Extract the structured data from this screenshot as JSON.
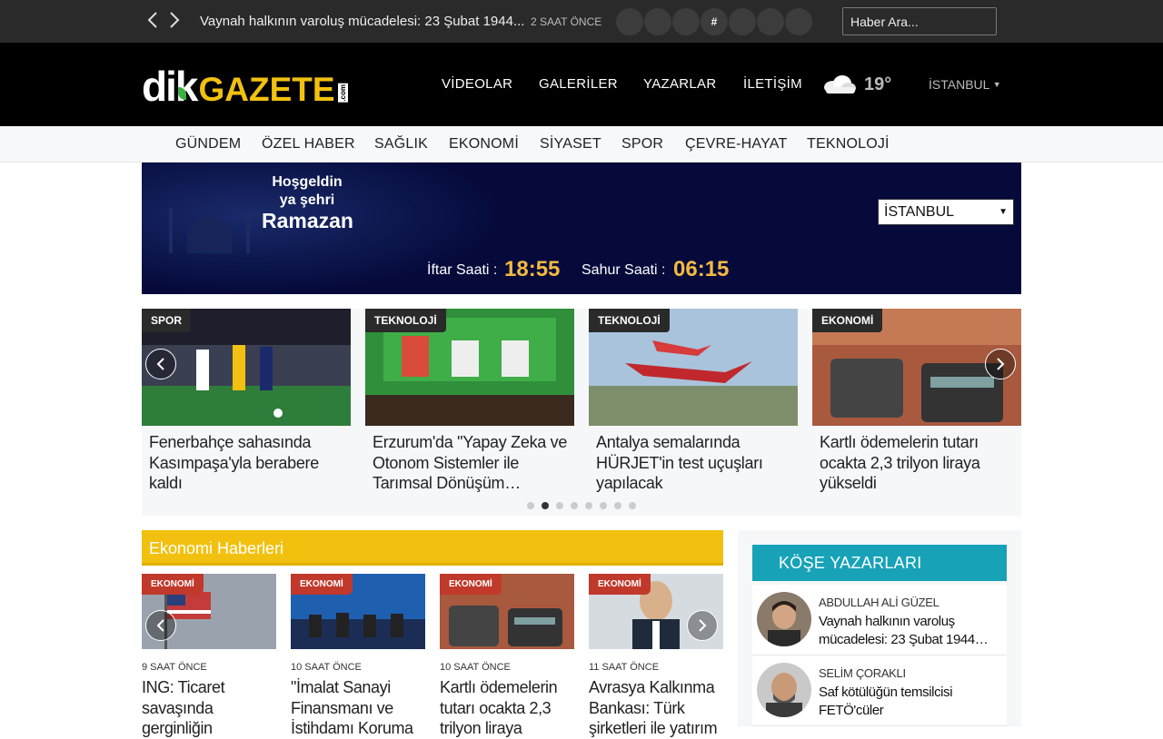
{
  "topbar": {
    "ticker_text": "Vaynah halkının varoluş mücadelesi: 23 Şubat 1944...",
    "ticker_time": "2 SAAT ÖNCE",
    "prev_icon": "chevron-left-icon",
    "next_icon": "chevron-right-icon",
    "social_hash": "#",
    "search_placeholder": "Haber Ara..."
  },
  "header": {
    "logo_dik": "dik",
    "logo_gazete": "GAZETE",
    "logo_com": ".com",
    "nav": [
      "VİDEOLAR",
      "GALERİLER",
      "YAZARLAR",
      "İLETİŞİM"
    ],
    "temperature": "19°",
    "city": "İSTANBUL",
    "weather_icon": "cloud-icon"
  },
  "categories": [
    "GÜNDEM",
    "ÖZEL HABER",
    "SAĞLIK",
    "EKONOMİ",
    "SİYASET",
    "SPOR",
    "ÇEVRE-HAYAT",
    "TEKNOLOJİ"
  ],
  "ramadan": {
    "line1": "Hoşgeldin",
    "line2": "ya şehri",
    "line3": "Ramazan",
    "city_select": "İSTANBUL",
    "iftar_label": "İftar Saati :",
    "iftar_value": "18:55",
    "sahur_label": "Sahur Saati :",
    "sahur_value": "06:15"
  },
  "slider": {
    "items": [
      {
        "category": "SPOR",
        "title": "Fenerbahçe sahasında Kasımpaşa'yla berabere kaldı"
      },
      {
        "category": "TEKNOLOJİ",
        "title": "Erzurum'da \"Yapay Zeka ve Otonom Sistemler ile Tarımsal Dönüşüm…"
      },
      {
        "category": "TEKNOLOJİ",
        "title": "Antalya semalarında HÜRJET'in test uçuşları yapılacak"
      },
      {
        "category": "EKONOMİ",
        "title": "Kartlı ödemelerin tutarı ocakta 2,3 trilyon liraya yükseldi"
      }
    ],
    "dot_count": 8,
    "active_dot": 1
  },
  "economy": {
    "heading": "Ekonomi Haberleri",
    "items": [
      {
        "category": "EKONOMİ",
        "time": "9 SAAT ÖNCE",
        "title": "ING: Ticaret savaşında gerginliğin"
      },
      {
        "category": "EKONOMİ",
        "time": "10 SAAT ÖNCE",
        "title": "\"İmalat Sanayi Finansmanı ve İstihdamı Koruma"
      },
      {
        "category": "EKONOMİ",
        "time": "10 SAAT ÖNCE",
        "title": "Kartlı ödemelerin tutarı ocakta 2,3 trilyon liraya"
      },
      {
        "category": "EKONOMİ",
        "time": "11 SAAT ÖNCE",
        "title": "Avrasya Kalkınma Bankası: Türk şirketleri ile yatırım"
      }
    ]
  },
  "columnists": {
    "heading": "KÖŞE YAZARLARI",
    "items": [
      {
        "name": "ABDULLAH ALİ GÜZEL",
        "article": "Vaynah halkının varoluş mücadelesi: 23 Şubat 1944…"
      },
      {
        "name": "SELİM ÇORAKLI",
        "article": "Saf kötülüğün temsilcisi FETÖ'cüler"
      }
    ]
  }
}
